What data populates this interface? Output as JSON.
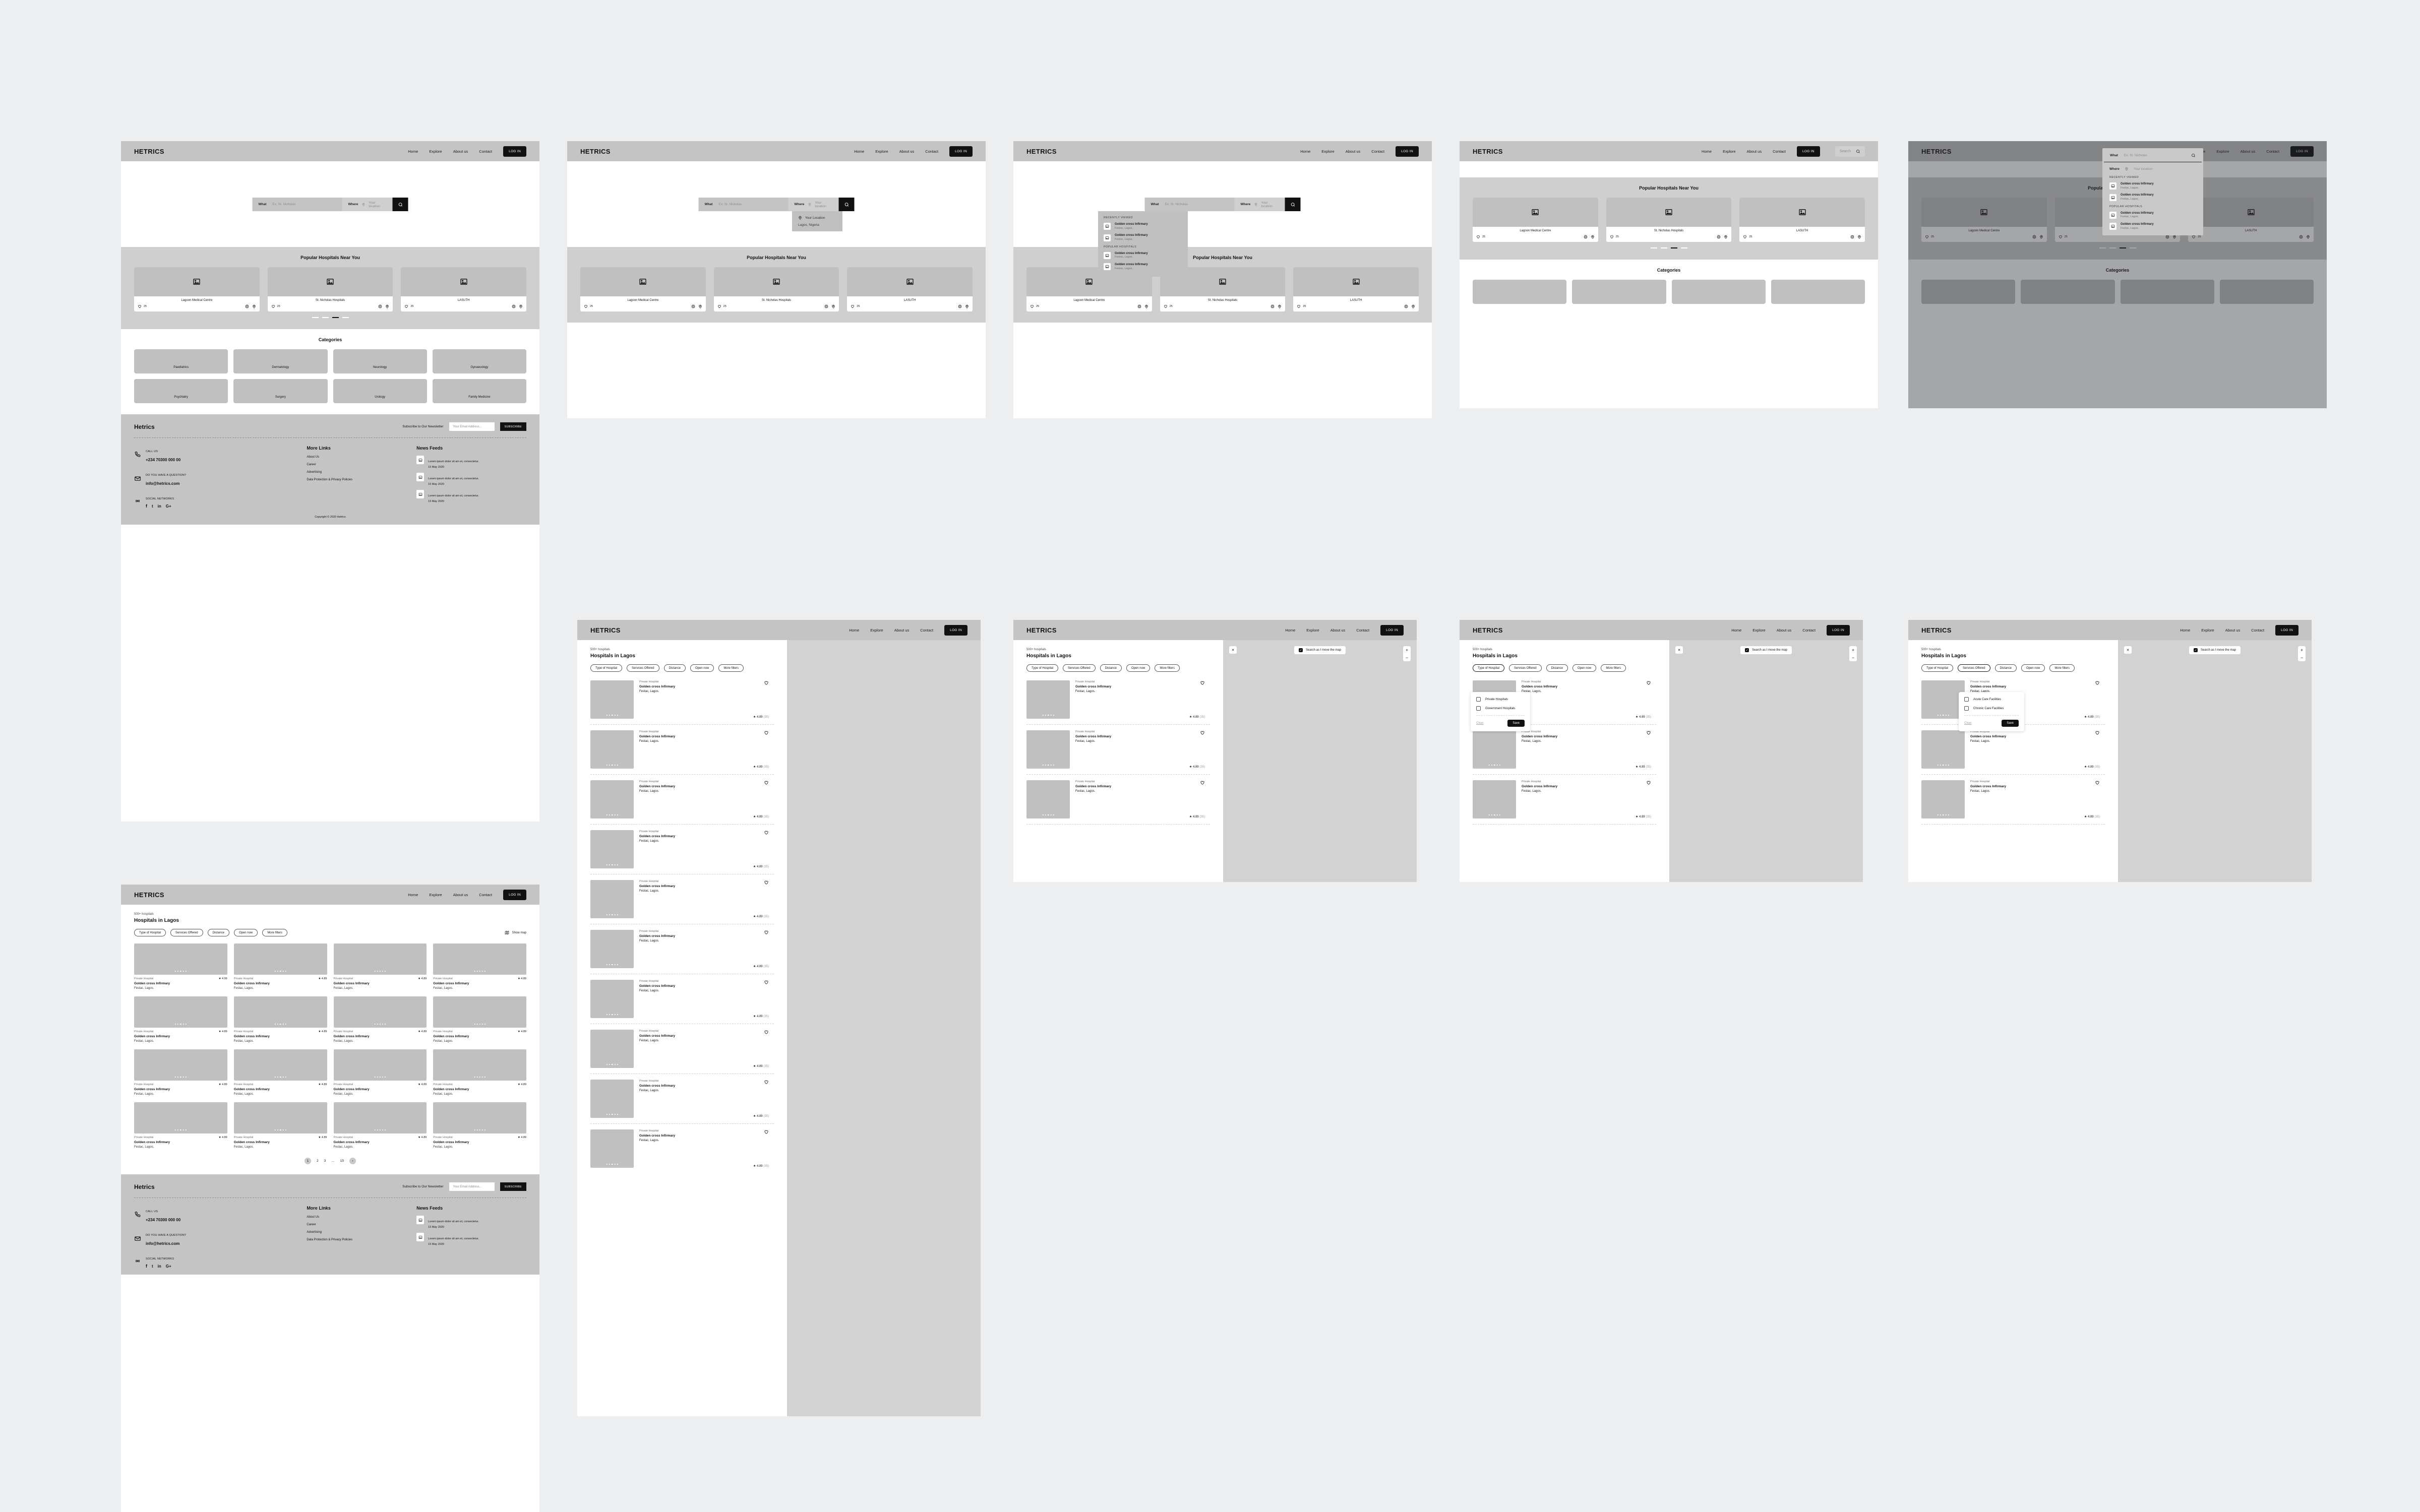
{
  "brand": "HETRICS",
  "footer_brand": "Hetrics",
  "nav": {
    "links": [
      "Home",
      "Explore",
      "About us",
      "Contact"
    ],
    "login": "LOG IN",
    "search_placeholder": "Search"
  },
  "search": {
    "what_label": "What",
    "what_placeholder": "Ex: St. Nicholas",
    "where_label": "Where",
    "where_placeholder": "Your location"
  },
  "where_dropdown": {
    "your_location": "Your Location",
    "city": "Lagos, Nigeria"
  },
  "what_dropdown": {
    "recently_viewed_head": "RECENTLY VIEWED",
    "popular_head": "POPULAR HOSPITALS",
    "recent": [
      {
        "name": "Golden cross Infirmary",
        "loc": "Festac, Lagos."
      },
      {
        "name": "Golden cross Infirmary",
        "loc": "Festac, Lagos."
      }
    ],
    "popular": [
      {
        "name": "Golden cross Infirmary",
        "loc": "Festac, Lagos."
      },
      {
        "name": "Golden cross Infirmary",
        "loc": "Festac, Lagos."
      }
    ]
  },
  "popular": {
    "title": "Popular Hospitals Near You",
    "cards": [
      {
        "name": "Lagoon Medical Centre",
        "likes": "25"
      },
      {
        "name": "St. Nicholas Hospitals",
        "likes": "25"
      },
      {
        "name": "LASUTH",
        "likes": "25"
      }
    ]
  },
  "categories": {
    "title": "Categories",
    "items": [
      "Paediatrics",
      "Dermatology",
      "Neurology",
      "Gynaecology",
      "Psychiatry",
      "Surgery",
      "Urology",
      "Family Medicine"
    ]
  },
  "footer": {
    "newsletter_label": "Subscribe to Our Newsletter",
    "email_placeholder": "Your Email Address...",
    "subscribe": "SUBSCRIBE",
    "call_us_label": "CALL US",
    "phone": "+234 70300 000 00",
    "question_label": "DO YOU HAVE A QUESTION?",
    "email": "info@hetrics.com",
    "social_label": "SOCIAL NETWORKS",
    "socials": [
      "f",
      "t",
      "in",
      "G+"
    ],
    "more_links_title": "More Links",
    "more_links": [
      "About Us",
      "Career",
      "Advertising",
      "Data Protection & Privacy Policies"
    ],
    "news_title": "News Feeds",
    "news": [
      {
        "text": "Lorem ipsum dolor sit am et, consectetur.",
        "date": "15 May 2020"
      },
      {
        "text": "Lorem ipsum dolor sit am et, consectetur.",
        "date": "15 May 2020"
      },
      {
        "text": "Lorem ipsum dolor sit am et, consectetur.",
        "date": "15 May 2020"
      }
    ],
    "copyright": "Copyright © 2020 Hetrics"
  },
  "listing": {
    "count": "500+ hospitals",
    "title": "Hospitals in Lagos",
    "chips": [
      "Type of Hospital",
      "Services Offered",
      "Distance",
      "Open now",
      "More filters"
    ],
    "show_map": "Show map",
    "map_search_label": "Search as I move the map",
    "item": {
      "type": "Private Hospital",
      "name": "Golden cross Infirmary",
      "loc": "Festac, Lagos.",
      "rating": "4.89",
      "rating_first": "4.99",
      "reviews": "(35)"
    },
    "pager": [
      "1",
      "2",
      "3",
      "…",
      "15"
    ]
  },
  "filters": {
    "type_of_hospital": {
      "options": [
        "Private Hospitals",
        "Government Hospitals"
      ],
      "clear": "Clear",
      "save": "Save"
    },
    "services_offered": {
      "options": [
        "Acute Care Facilities",
        "Chronic Care Facilities"
      ],
      "clear": "Clear",
      "save": "Save"
    }
  },
  "colors": {
    "canvas": "#eceef0",
    "nav_grey": "#c4c4c4",
    "section_grey": "#cfcfcf",
    "placeholder_grey": "#c0c0c0",
    "dark": "#111111"
  }
}
